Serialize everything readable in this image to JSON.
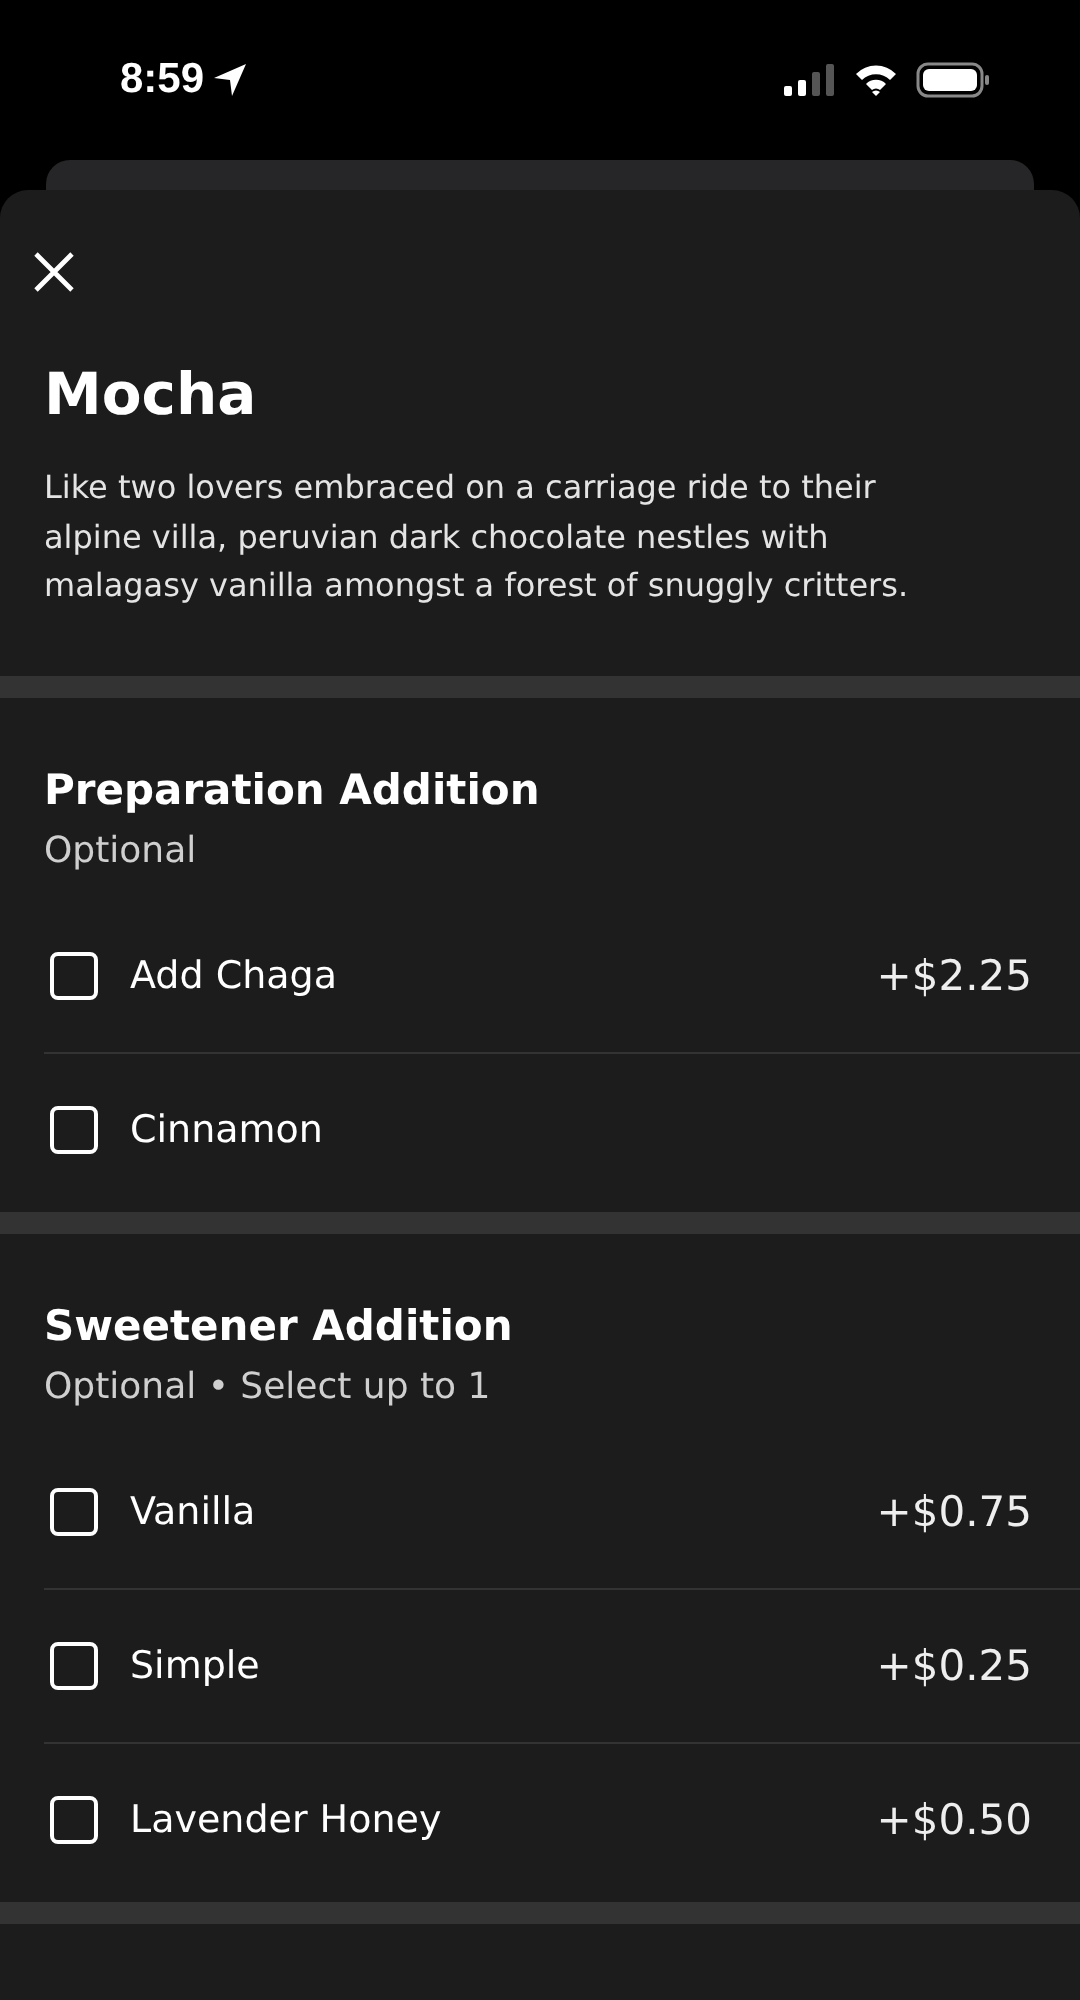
{
  "status_bar": {
    "time": "8:59"
  },
  "item": {
    "title": "Mocha",
    "description": "Like two lovers embraced on a carriage ride to their alpine villa, peruvian dark chocolate nestles with malagasy vanilla amongst a forest of snuggly critters."
  },
  "sections": [
    {
      "title": "Preparation Addition",
      "subtitle": "Optional",
      "options": [
        {
          "label": "Add Chaga",
          "price": "+$2.25",
          "checked": false
        },
        {
          "label": "Cinnamon",
          "checked": false
        }
      ]
    },
    {
      "title": "Sweetener Addition",
      "subtitle": "Optional • Select up to 1",
      "options": [
        {
          "label": "Vanilla",
          "price": "+$0.75",
          "checked": false
        },
        {
          "label": "Simple",
          "price": "+$0.25",
          "checked": false
        },
        {
          "label": "Lavender Honey",
          "price": "+$0.50",
          "checked": false
        }
      ]
    }
  ]
}
